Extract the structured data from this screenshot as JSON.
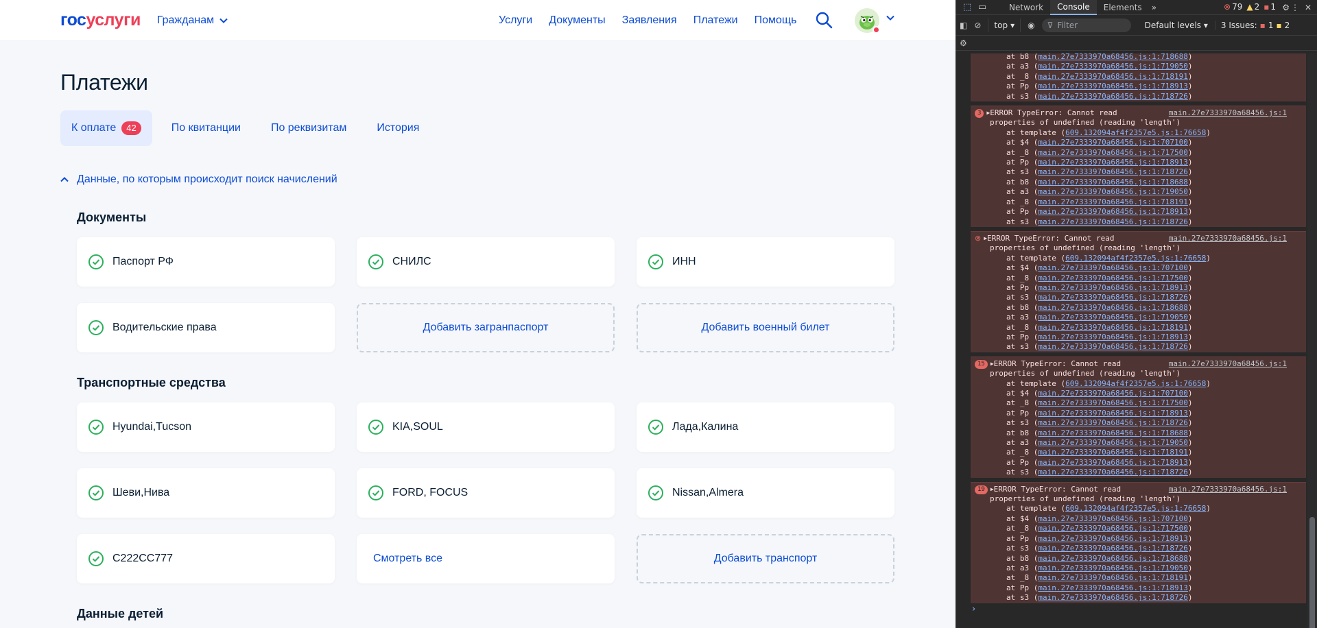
{
  "header": {
    "logo_part1": "гос",
    "logo_part2": "услуги",
    "audience": "Гражданам",
    "nav": [
      "Услуги",
      "Документы",
      "Заявления",
      "Платежи",
      "Помощь"
    ]
  },
  "page": {
    "title": "Платежи",
    "tabs": [
      {
        "label": "К оплате",
        "badge": "42",
        "active": true
      },
      {
        "label": "По квитанции"
      },
      {
        "label": "По реквизитам"
      },
      {
        "label": "История"
      }
    ],
    "search_data_toggle": "Данные, по которым происходит поиск начислений"
  },
  "documents": {
    "title": "Документы",
    "items": [
      "Паспорт РФ",
      "СНИЛС",
      "ИНН",
      "Водительские права"
    ],
    "add_passport": "Добавить загранпаспорт",
    "add_military": "Добавить военный билет"
  },
  "transport": {
    "title": "Транспортные средства",
    "items": [
      "Hyundai,Tucson",
      "KIA,SOUL",
      "Лада,Калина",
      "Шеви,Нива",
      "FORD, FOCUS",
      "Nissan,Almera",
      "С222СС777"
    ],
    "see_all": "Смотреть все",
    "add": "Добавить транспорт"
  },
  "children": {
    "title": "Данные детей"
  },
  "devtools": {
    "tabs": [
      "Network",
      "Console",
      "Elements"
    ],
    "active_tab": "Console",
    "errors_count": "79",
    "warnings_count": "2",
    "info_count": "1",
    "context": "top",
    "filter_placeholder": "Filter",
    "levels": "Default levels",
    "issues_label": "3 Issues:",
    "issues_err": "1",
    "issues_warn": "2",
    "prompt": "›",
    "colors": {
      "error_bg": "#4e3534",
      "link": "#8ab4f8",
      "brand": "#0d4cd3",
      "accent": "#ee3f58"
    },
    "trailing_frames": [
      {
        "fn": "b8",
        "src": "main.27e7333970a68456.js:1:718688"
      },
      {
        "fn": "a3",
        "src": "main.27e7333970a68456.js:1:719050"
      },
      {
        "fn": "_8",
        "src": "main.27e7333970a68456.js:1:718191"
      },
      {
        "fn": "Pp",
        "src": "main.27e7333970a68456.js:1:718913"
      },
      {
        "fn": "s3",
        "src": "main.27e7333970a68456.js:1:718726"
      }
    ],
    "messages": [
      {
        "repeat": "3",
        "line1": "ERROR TypeError: Cannot read",
        "line2": "properties of undefined (reading 'length')",
        "src": "main.27e7333970a68456.js:1"
      },
      {
        "repeat": "",
        "line1": "ERROR TypeError: Cannot read",
        "line2": "properties of undefined (reading 'length')",
        "src": "main.27e7333970a68456.js:1"
      },
      {
        "repeat": "15",
        "line1": "ERROR TypeError: Cannot read",
        "line2": "properties of undefined (reading 'length')",
        "src": "main.27e7333970a68456.js:1"
      },
      {
        "repeat": "19",
        "line1": "ERROR TypeError: Cannot read",
        "line2": "properties of undefined (reading 'length')",
        "src": "main.27e7333970a68456.js:1"
      }
    ],
    "frames": [
      {
        "fn": "template",
        "src": "609.132094af4f2357e5.js:1:76658"
      },
      {
        "fn": "$4",
        "src": "main.27e7333970a68456.js:1:707100"
      },
      {
        "fn": "_8",
        "src": "main.27e7333970a68456.js:1:717500"
      },
      {
        "fn": "Pp",
        "src": "main.27e7333970a68456.js:1:718913"
      },
      {
        "fn": "s3",
        "src": "main.27e7333970a68456.js:1:718726"
      },
      {
        "fn": "b8",
        "src": "main.27e7333970a68456.js:1:718688"
      },
      {
        "fn": "a3",
        "src": "main.27e7333970a68456.js:1:719050"
      },
      {
        "fn": "_8",
        "src": "main.27e7333970a68456.js:1:718191"
      },
      {
        "fn": "Pp",
        "src": "main.27e7333970a68456.js:1:718913"
      },
      {
        "fn": "s3",
        "src": "main.27e7333970a68456.js:1:718726"
      }
    ]
  }
}
